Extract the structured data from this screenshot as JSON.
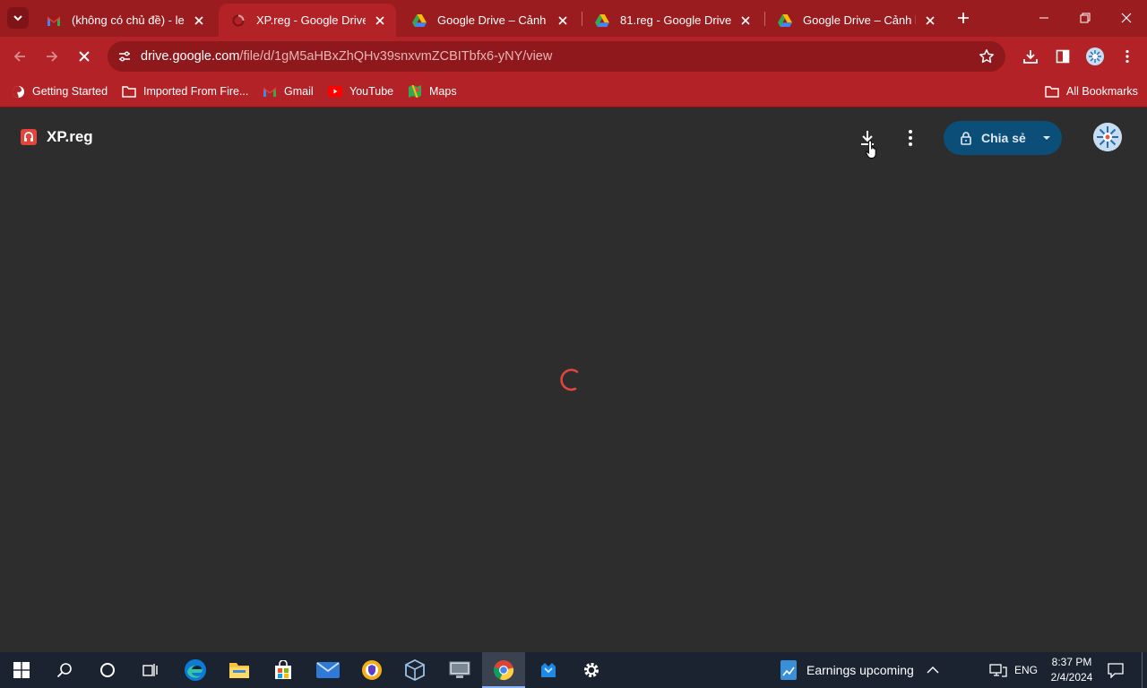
{
  "browser": {
    "tabs": [
      {
        "title": "(không có chủ đề) - lecon",
        "favicon": "gmail-icon",
        "active": false
      },
      {
        "title": "XP.reg - Google Drive",
        "favicon": "loading-icon",
        "active": true
      },
      {
        "title": "Google Drive – Cảnh báo",
        "favicon": "google-drive-icon",
        "active": false
      },
      {
        "title": "81.reg - Google Drive",
        "favicon": "google-drive-icon",
        "active": false
      },
      {
        "title": "Google Drive – Cảnh báo",
        "favicon": "google-drive-icon",
        "active": false
      }
    ],
    "url": {
      "domain": "drive.google.com",
      "path": "/file/d/1gM5aHBxZhQHv39snxvmZCBITbfx6-yNY/view"
    },
    "bookmarks": [
      {
        "label": "Getting Started",
        "icon": "firefox-icon"
      },
      {
        "label": "Imported From Fire...",
        "icon": "folder-icon"
      },
      {
        "label": "Gmail",
        "icon": "gmail-icon"
      },
      {
        "label": "YouTube",
        "icon": "youtube-icon"
      },
      {
        "label": "Maps",
        "icon": "maps-icon"
      }
    ],
    "all_bookmarks_label": "All Bookmarks",
    "theme_color": "#b32226"
  },
  "viewer": {
    "file_name": "XP.reg",
    "share_label": "Chia sẻ",
    "status": "loading"
  },
  "taskbar": {
    "news_label": "Earnings upcoming",
    "language": "ENG",
    "time": "8:37 PM",
    "date": "2/4/2024"
  }
}
